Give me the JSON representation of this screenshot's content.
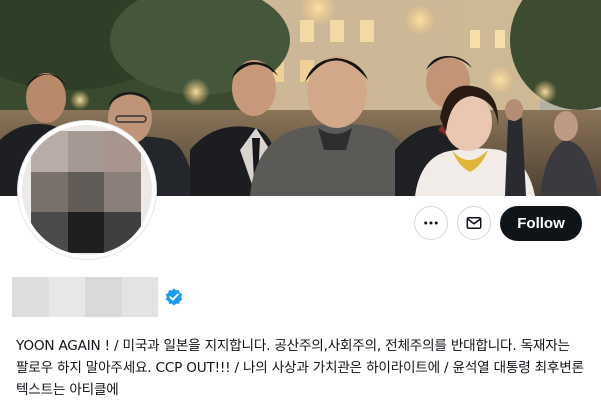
{
  "profile": {
    "follow_label": "Follow",
    "bio": "YOON AGAIN ! / 미국과 일본을 지지합니다. 공산주의,사회주의, 전체주의를 반대합니다. 독재자는 팔로우 하지 말아주세요. CCP OUT!!! / 나의 사상과 가치관은 하이라이트에 / 윤석열 대통령 최후변론 텍스트는 아티클에",
    "display_name_obscured": true,
    "verified": true
  },
  "icons": {
    "more": "more-horizontal-icon",
    "message": "envelope-icon",
    "verified": "verified-badge-icon"
  },
  "colors": {
    "follow_button_bg": "#0f1419",
    "follow_button_text": "#ffffff",
    "verified_badge": "#1d9bf0",
    "text": "#0f1419",
    "border": "#cfd9de"
  }
}
